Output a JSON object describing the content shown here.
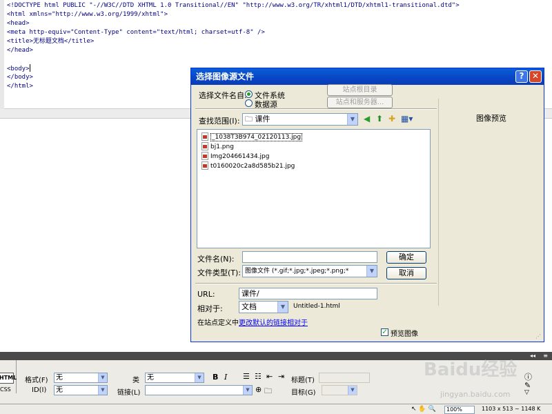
{
  "code_editor": {
    "lines": [
      "<!DOCTYPE html PUBLIC \"-//W3C//DTD XHTML 1.0 Transitional//EN\" \"http://www.w3.org/TR/xhtml1/DTD/xhtml1-transitional.dtd\">",
      "<html xmlns=\"http://www.w3.org/1999/xhtml\">",
      "<head>",
      "<meta http-equiv=\"Content-Type\" content=\"text/html; charset=utf-8\" />",
      "<title>无标题文档</title>",
      "</head>",
      "",
      "<body>",
      "</body>",
      "</html>"
    ]
  },
  "dialog": {
    "title": "选择图像源文件",
    "help_label": "?",
    "close_label": "✕",
    "select_from_label": "选择文件名自:",
    "radio_filesystem": "文件系统",
    "radio_datasource": "数据源",
    "site_root_button": "站点根目录",
    "sites_servers_button": "站点和服务器...",
    "lookin_label": "查找范围(I):",
    "lookin_value": "课件",
    "files": [
      "_1038T3B974_02120113.jpg",
      "bj1.png",
      "Img204661434.jpg",
      "t0160020c2a8d585b21.jpg"
    ],
    "filename_label": "文件名(N):",
    "filename_value": "",
    "filetype_label": "文件类型(T):",
    "filetype_value": "图像文件 (*.gif;*.jpg;*.jpeg;*.png;*",
    "ok_button": "确定",
    "cancel_button": "取消",
    "preview_label": "图像预览",
    "url_label": "URL:",
    "url_value": "课件/",
    "relative_label": "相对于:",
    "relative_value": "文档",
    "relative_file": "Untitled-1.html",
    "site_def_text": "在站点定义中",
    "site_def_link": "更改默认的链接相对于",
    "preview_checkbox": "预览图像"
  },
  "properties": {
    "html_tab": "HTML",
    "css_tab": "CSS",
    "format_label": "格式(F)",
    "format_value": "无",
    "class_label": "类",
    "class_value": "无",
    "id_label": "ID(I)",
    "id_value": "无",
    "link_label": "链接(L)",
    "link_value": "",
    "title_label": "标题(T)",
    "target_label": "目标(G)",
    "bold": "B",
    "italic": "I"
  },
  "status": {
    "zoom": "100%",
    "size": "1103 x 513 ~ 1148 K"
  },
  "watermark": {
    "main": "Baidu经验",
    "sub": "jingyan.baidu.com"
  }
}
